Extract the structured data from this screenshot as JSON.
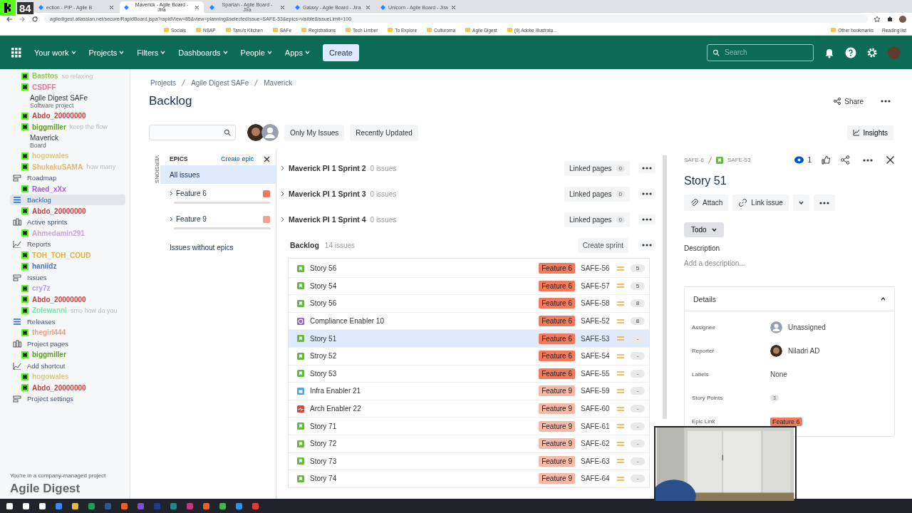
{
  "browser": {
    "tabs": [
      {
        "title": "ection - PIP - Agile B",
        "selected": false
      },
      {
        "title": "Maverick - Agile Board - Jira",
        "selected": true
      },
      {
        "title": "Spartan - Agile Board - Jira",
        "selected": false
      },
      {
        "title": "Galaxy - Agile Board - Jira",
        "selected": false
      },
      {
        "title": "Unicorn - Agile Board - Jira",
        "selected": false
      }
    ],
    "url": "agiledigest.atlassian.net/secure/RapidBoard.jspa?rapidView=85&view=planning&selectedIssue=SAFE-53&epics=visible&issueLimit=100",
    "bookmarks": [
      "Socials",
      "NSAP",
      "Tanu's Kitchen",
      "SAFe",
      "Registrations",
      "Tech Limber",
      "To Explore",
      "Culturoma",
      "Agile Digest",
      "(9) Adobe Illustrato..."
    ],
    "other_bookmarks": "Other bookmarks",
    "reading_list": "Reading list"
  },
  "stream_overlay": {
    "viewer_count": "84"
  },
  "jira_nav": {
    "items": [
      "Your work",
      "Projects",
      "Filters",
      "Dashboards",
      "People",
      "Apps"
    ],
    "create": "Create",
    "search_placeholder": "Search"
  },
  "sidebar": {
    "entries": [
      {
        "kind": "chat",
        "user": "Basttos",
        "message": "so relaxing",
        "color": "#8fd14f"
      },
      {
        "kind": "chat",
        "user": "CSDFF",
        "color": "#e8749a"
      },
      {
        "kind": "project",
        "title": "Agile Digest SAFe",
        "subtitle": "Software project"
      },
      {
        "kind": "chat",
        "user": "Abdo_20000000",
        "color": "#d03a3a"
      },
      {
        "kind": "chat",
        "user": "biggmiller",
        "message": "keep the flow",
        "color": "#5e9a1c"
      },
      {
        "kind": "board",
        "title": "Maverick",
        "subtitle": "Board"
      },
      {
        "kind": "chat",
        "user": "hogowales",
        "color": "#d8c98a"
      },
      {
        "kind": "chat",
        "user": "ShukakuSAMA",
        "message": "how many",
        "color": "#e6b86a"
      },
      {
        "kind": "nav",
        "label": "Roadmap",
        "selected": false
      },
      {
        "kind": "chat",
        "user": "Raed_xXx",
        "color": "#9b5de5"
      },
      {
        "kind": "nav",
        "label": "Backlog",
        "selected": true
      },
      {
        "kind": "chat",
        "user": "Abdo_20000000",
        "color": "#d03a3a"
      },
      {
        "kind": "nav",
        "label": "Active sprints",
        "selected": false
      },
      {
        "kind": "chat",
        "user": "Ahmedamin291",
        "color": "#c8a2e8"
      },
      {
        "kind": "nav",
        "label": "Reports",
        "selected": false
      },
      {
        "kind": "chat",
        "user": "TOH_TOH_COUD",
        "color": "#e0b040"
      },
      {
        "kind": "chat",
        "user": "haniidz",
        "color": "#4a6fc9"
      },
      {
        "kind": "nav",
        "label": "Issues",
        "selected": false
      },
      {
        "kind": "chat",
        "user": "cry7z",
        "color": "#b49be8"
      },
      {
        "kind": "chat",
        "user": "Abdo_20000000",
        "color": "#d03a3a"
      },
      {
        "kind": "chat",
        "user": "Zolewanni",
        "message": "smo how do you",
        "color": "#7de0b0"
      },
      {
        "kind": "nav",
        "label": "Releases",
        "selected": false
      },
      {
        "kind": "chat",
        "user": "thegirl444",
        "color": "#e8a080"
      },
      {
        "kind": "nav",
        "label": "Project pages",
        "selected": false
      },
      {
        "kind": "chat",
        "user": "biggmiller",
        "color": "#5e9a1c"
      },
      {
        "kind": "nav",
        "label": "Add shortcut",
        "selected": false
      },
      {
        "kind": "chat",
        "user": "hogowales",
        "color": "#d8c98a"
      },
      {
        "kind": "chat",
        "user": "Abdo_20000000",
        "color": "#d03a3a"
      },
      {
        "kind": "nav",
        "label": "Project settings",
        "selected": false
      }
    ],
    "footer": "You're in a company-managed project",
    "brand": "Agile Digest"
  },
  "breadcrumbs": [
    "Projects",
    "Agile Digest SAFe",
    "Maverick"
  ],
  "title": "Backlog",
  "toolbar": {
    "filters": [
      "Only My Issues",
      "Recently Updated"
    ],
    "insights": "Insights",
    "share": "Share"
  },
  "epics": {
    "versions_label": "VERSIONS",
    "header": "EPICS",
    "create": "Create epic",
    "items": [
      {
        "label": "All issues",
        "selected": true
      },
      {
        "label": "Feature 6",
        "selected": false,
        "color": "#f07a5c"
      },
      {
        "label": "Feature 9",
        "selected": false,
        "color": "#f5a08a"
      }
    ],
    "without": "Issues without epics"
  },
  "sprints": [
    {
      "name": "Maverick PI 1 Sprint 2",
      "count": "0 issues",
      "linked": "Linked pages",
      "linked_count": "0"
    },
    {
      "name": "Maverick PI 1 Sprint 3",
      "count": "0 issues",
      "linked": "Linked pages",
      "linked_count": "0"
    },
    {
      "name": "Maverick PI 1 Sprint 4",
      "count": "0 issues",
      "linked": "Linked pages",
      "linked_count": "0"
    }
  ],
  "backlog": {
    "title": "Backlog",
    "count": "14 issues",
    "create": "Create sprint",
    "issues": [
      {
        "kind": "story",
        "summary": "Story 56",
        "epic": "Feature 6",
        "color": "#f07a5c",
        "key": "SAFE-56",
        "points": "5",
        "selected": false
      },
      {
        "kind": "story",
        "summary": "Story 54",
        "epic": "Feature 6",
        "color": "#f07a5c",
        "key": "SAFE-57",
        "points": "5",
        "selected": false
      },
      {
        "kind": "story",
        "summary": "Story 56",
        "epic": "Feature 6",
        "color": "#f07a5c",
        "key": "SAFE-58",
        "points": "8",
        "selected": false
      },
      {
        "kind": "compliance",
        "summary": "Compliance Enabler 10",
        "epic": "Feature 6",
        "color": "#f07a5c",
        "key": "SAFE-52",
        "points": "8",
        "selected": false
      },
      {
        "kind": "story",
        "summary": "Story 51",
        "epic": "Feature 6",
        "color": "#f07a5c",
        "key": "SAFE-53",
        "points": "-",
        "selected": true
      },
      {
        "kind": "story",
        "summary": "Stroy 52",
        "epic": "Feature 6",
        "color": "#f07a5c",
        "key": "SAFE-54",
        "points": "-",
        "selected": false
      },
      {
        "kind": "story",
        "summary": "Story 53",
        "epic": "Feature 6",
        "color": "#f07a5c",
        "key": "SAFE-55",
        "points": "-",
        "selected": false
      },
      {
        "kind": "infra",
        "summary": "Infra Enabler 21",
        "epic": "Feature 9",
        "color": "#f8b8a6",
        "key": "SAFE-59",
        "points": "-",
        "selected": false
      },
      {
        "kind": "arch",
        "summary": "Arch Enabler 22",
        "epic": "Feature 9",
        "color": "#f8b8a6",
        "key": "SAFE-60",
        "points": "-",
        "selected": false
      },
      {
        "kind": "story",
        "summary": "Story 71",
        "epic": "Feature 9",
        "color": "#f8b8a6",
        "key": "SAFE-61",
        "points": "-",
        "selected": false
      },
      {
        "kind": "story",
        "summary": "Story 72",
        "epic": "Feature 9",
        "color": "#f8b8a6",
        "key": "SAFE-62",
        "points": "-",
        "selected": false
      },
      {
        "kind": "story",
        "summary": "Story 73",
        "epic": "Feature 9",
        "color": "#f8b8a6",
        "key": "SAFE-63",
        "points": "-",
        "selected": false
      },
      {
        "kind": "story",
        "summary": "Story 74",
        "epic": "Feature 9",
        "color": "#f8b8a6",
        "key": "SAFE-64",
        "points": "-",
        "selected": false
      }
    ]
  },
  "detail": {
    "parent": "SAFE-6",
    "key": "SAFE-53",
    "watchers": "1",
    "title": "Story 51",
    "attach": "Attach",
    "link_issue": "Link issue",
    "status": "Todo",
    "description_label": "Description",
    "description_placeholder": "Add a description...",
    "details_title": "Details",
    "fields": [
      {
        "kind": "unassigned",
        "label": "Assignee",
        "value": "Unassigned"
      },
      {
        "kind": "person",
        "label": "Reporter",
        "value": "Niladri AD"
      },
      {
        "kind": "text",
        "label": "Labels",
        "value": "None"
      },
      {
        "kind": "points",
        "label": "Story Points",
        "value": "3"
      },
      {
        "kind": "epic",
        "label": "Epic Link",
        "value": "Feature 6",
        "color": "#f07a5c"
      }
    ]
  }
}
